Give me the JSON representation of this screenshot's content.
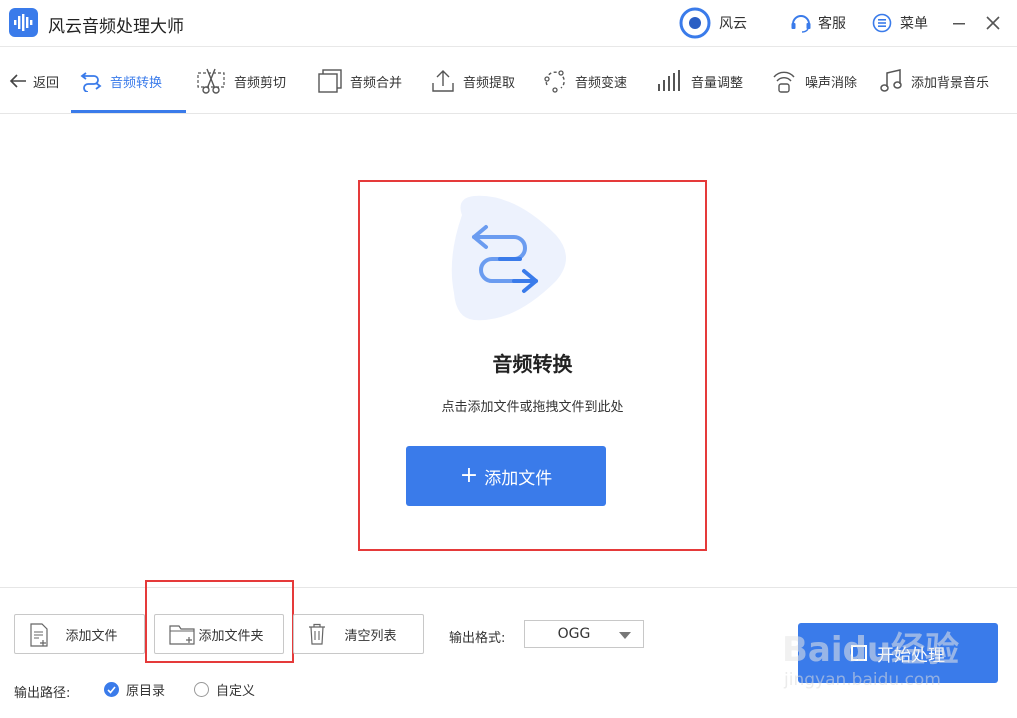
{
  "app": {
    "title": "风云音频处理大师",
    "accent_color": "#3a7bea",
    "highlight_color": "#e53a3a"
  },
  "header": {
    "account_label": "风云",
    "service_label": "客服",
    "menu_label": "菜单",
    "icons": [
      "app-logo-waveform-icon",
      "fengyun-logo-icon",
      "headset-icon",
      "menu-list-icon",
      "minimize-icon",
      "close-icon"
    ]
  },
  "toolbar": {
    "back_label": "返回",
    "tools": [
      {
        "label": "音频转换",
        "icon": "convert-arrows-icon",
        "active": true
      },
      {
        "label": "音频剪切",
        "icon": "scissors-icon",
        "active": false
      },
      {
        "label": "音频合并",
        "icon": "merge-squares-icon",
        "active": false
      },
      {
        "label": "音频提取",
        "icon": "upload-tray-icon",
        "active": false
      },
      {
        "label": "音频变速",
        "icon": "speed-dots-icon",
        "active": false
      },
      {
        "label": "音量调整",
        "icon": "volume-bars-icon",
        "active": false
      },
      {
        "label": "噪声消除",
        "icon": "noise-wave-icon",
        "active": false
      },
      {
        "label": "添加背景音乐",
        "icon": "music-note-icon",
        "active": false
      }
    ]
  },
  "dropzone": {
    "title": "音频转换",
    "hint": "点击添加文件或拖拽文件到此处",
    "add_button_label": "添加文件",
    "add_button_icon": "plus-icon",
    "illustration_icon": "convert-arrows-icon"
  },
  "bottom": {
    "add_file_label": "添加文件",
    "add_folder_label": "添加文件夹",
    "clear_list_label": "清空列表",
    "format_label": "输出格式:",
    "format_value": "OGG",
    "start_label": "开始处理",
    "path_label": "输出路径:",
    "path_options": [
      {
        "label": "原目录",
        "checked": true
      },
      {
        "label": "自定义",
        "checked": false
      }
    ]
  },
  "watermark": {
    "brand": "Baidu经验",
    "url": "jingyan.baidu.com"
  }
}
